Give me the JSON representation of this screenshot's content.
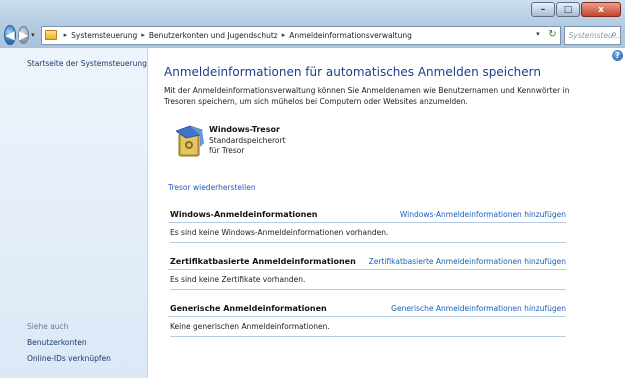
{
  "window": {
    "controls": {
      "minimize": "–",
      "maximize": "□",
      "close": "x"
    }
  },
  "nav": {
    "back_glyph": "◀",
    "forward_glyph": "▶",
    "dropdown_glyph": "▾",
    "breadcrumbs": [
      "Systemsteuerung",
      "Benutzerkonten und Jugendschutz",
      "Anmeldeinformationsverwaltung"
    ],
    "separator": "▸",
    "addr_dropdown_glyph": "▾",
    "refresh_glyph": "↻",
    "search_placeholder": "Systemsteu...",
    "search_icon": "⌕"
  },
  "sidebar": {
    "home": "Startseite der Systemsteuerung",
    "see_also": "Siehe auch",
    "links": [
      "Benutzerkonten",
      "Online-IDs verknüpfen"
    ]
  },
  "main": {
    "help_glyph": "?",
    "title": "Anmeldeinformationen für automatisches Anmelden speichern",
    "description": "Mit der Anmeldeinformationsverwaltung können Sie Anmeldenamen wie Benutzernamen und Kennwörter in Tresoren speichern, um sich mühelos bei Computern oder Websites anzumelden.",
    "vault": {
      "name": "Windows-Tresor",
      "sub1": "Standardspeicherort",
      "sub2": "für Tresor"
    },
    "restore_link": "Tresor wiederherstellen",
    "sections": [
      {
        "title": "Windows-Anmeldeinformationen",
        "link": "Windows-Anmeldeinformationen hinzufügen",
        "body": "Es sind keine Windows-Anmeldeinformationen vorhanden."
      },
      {
        "title": "Zertifikatbasierte Anmeldeinformationen",
        "link": "Zertifikatbasierte Anmeldeinformationen hinzufügen",
        "body": "Es sind keine Zertifikate vorhanden."
      },
      {
        "title": "Generische Anmeldeinformationen",
        "link": "Generische Anmeldeinformationen hinzufügen",
        "body": "Keine generischen Anmeldeinformationen."
      }
    ]
  }
}
